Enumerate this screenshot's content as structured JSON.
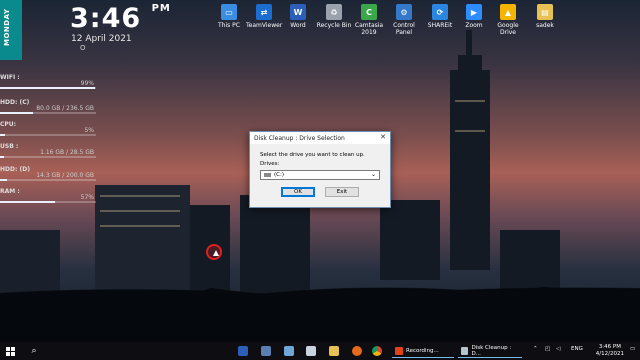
{
  "widget": {
    "day": "MONDAY",
    "time": "3:46",
    "ampm": "PM",
    "date": "12 April 2021",
    "date_extra": "O",
    "stats": [
      {
        "label": "WIFI :",
        "value": "99%",
        "fraction": 0.99
      },
      {
        "label": "HDD: (C)",
        "value": "80.0 GB / 236.5 GB",
        "fraction": 0.34
      },
      {
        "label": "CPU:",
        "value": "5%",
        "fraction": 0.05
      },
      {
        "label": "USB :",
        "value": "1.16 GB / 28.5 GB",
        "fraction": 0.04
      },
      {
        "label": "HDD: (D)",
        "value": "14.3 GB / 200.0 GB",
        "fraction": 0.07
      },
      {
        "label": "RAM :",
        "value": "57%",
        "fraction": 0.57
      }
    ]
  },
  "desktop_icons": [
    {
      "label": "This PC",
      "icon": "this-pc-icon",
      "color": "#3a8de0",
      "glyph": "▭"
    },
    {
      "label": "TeamViewer",
      "icon": "teamviewer-icon",
      "color": "#1b6ed0",
      "glyph": "⇄"
    },
    {
      "label": "Word",
      "icon": "word-icon",
      "color": "#2b5fb8",
      "glyph": "W"
    },
    {
      "label": "Recycle Bin",
      "icon": "recycle-bin-icon",
      "color": "#9aa3ad",
      "glyph": "♻"
    },
    {
      "label": "Camtasia 2019",
      "icon": "camtasia-icon",
      "color": "#3aa84a",
      "glyph": "C"
    },
    {
      "label": "Control Panel",
      "icon": "control-panel-icon",
      "color": "#3378c9",
      "glyph": "⚙"
    },
    {
      "label": "SHAREit",
      "icon": "shareit-icon",
      "color": "#2a86e0",
      "glyph": "⟳"
    },
    {
      "label": "Zoom",
      "icon": "zoom-icon",
      "color": "#2d8cff",
      "glyph": "▶"
    },
    {
      "label": "Google Drive",
      "icon": "google-drive-icon",
      "color": "#f4b400",
      "glyph": "▲"
    },
    {
      "label": "sadek",
      "icon": "folder-icon",
      "color": "#e8c155",
      "glyph": "▤"
    }
  ],
  "dialog": {
    "title": "Disk Cleanup : Drive Selection",
    "message": "Select the drive you want to clean up.",
    "drives_label": "Drives:",
    "selected_drive": "(C:)",
    "ok_label": "OK",
    "exit_label": "Exit"
  },
  "taskbar": {
    "apps": [
      {
        "label": "Recording...",
        "icon": "recording-icon"
      },
      {
        "label": "Disk Cleanup : D...",
        "icon": "disk-cleanup-icon"
      }
    ],
    "language": "ENG",
    "time": "3:46 PM",
    "date": "4/12/2021"
  },
  "colors": {
    "accent_teal": "#0a8a8c",
    "dialog_border": "#6d8db4",
    "default_button": "#0078d7"
  }
}
